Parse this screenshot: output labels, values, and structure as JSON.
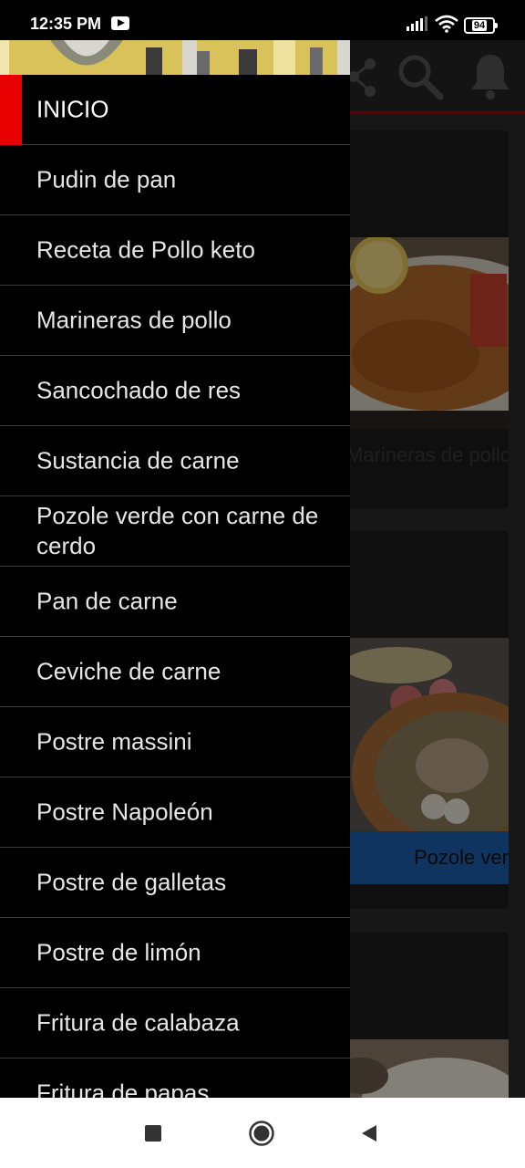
{
  "status": {
    "time": "12:35 PM",
    "battery": "94"
  },
  "app": {
    "cards": [
      {
        "caption": "Marineras de pollo",
        "caption_color": "#3a3a3a",
        "caption_bg": "#1c1c1c"
      },
      {
        "caption": "Pozole verde con carne de cerdo",
        "caption_color": "#1a1a1a",
        "caption_bg": "#1e5fb0"
      },
      {
        "caption": "",
        "caption_color": "#1a1a1a",
        "caption_bg": "#1c1c1c"
      }
    ]
  },
  "drawer": {
    "items": [
      {
        "label": "INICIO",
        "active": true
      },
      {
        "label": "Pudin de pan"
      },
      {
        "label": "Receta de Pollo keto"
      },
      {
        "label": "Marineras de pollo"
      },
      {
        "label": "Sancochado de res"
      },
      {
        "label": "Sustancia de carne"
      },
      {
        "label": "Pozole verde con carne de cerdo"
      },
      {
        "label": "Pan de carne"
      },
      {
        "label": "Ceviche de carne"
      },
      {
        "label": "Postre massini"
      },
      {
        "label": "Postre Napoleón"
      },
      {
        "label": "Postre de galletas"
      },
      {
        "label": "Postre de limón"
      },
      {
        "label": "Fritura de calabaza"
      },
      {
        "label": "Fritura de papas"
      }
    ]
  },
  "colors": {
    "accent": "#e60000",
    "nav_bar": "#ffffff"
  }
}
